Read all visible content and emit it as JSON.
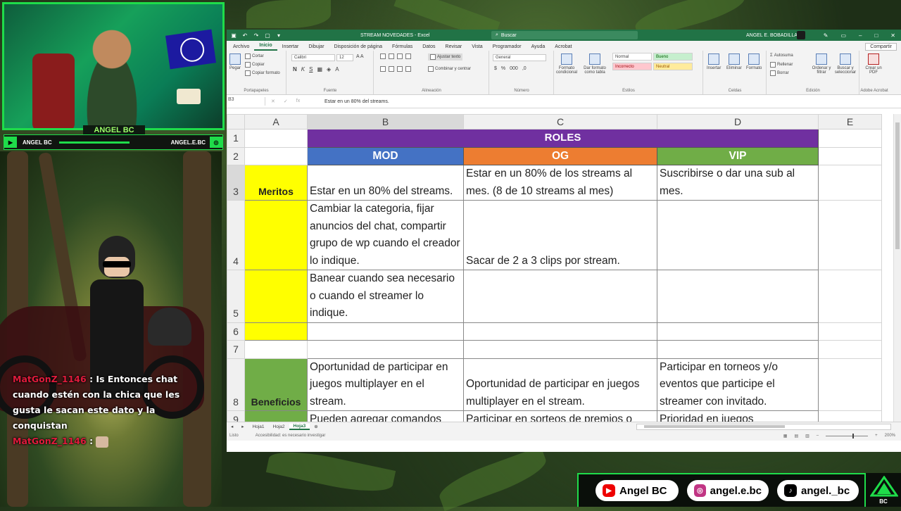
{
  "excel": {
    "title": {
      "doc": "STREAM NOVEDADES  -  Excel",
      "search": "Buscar",
      "user": "ANGEL E. BOBADILLA"
    },
    "tabs": [
      "Archivo",
      "Inicio",
      "Insertar",
      "Dibujar",
      "Disposición de página",
      "Fórmulas",
      "Datos",
      "Revisar",
      "Vista",
      "Programador",
      "Ayuda",
      "Acrobat"
    ],
    "share": "Compartir",
    "ribbon": {
      "clipboard": {
        "paste": "Pegar",
        "cut": "Cortar",
        "copy": "Copiar",
        "format_painter": "Copiar formato",
        "label": "Portapapeles"
      },
      "font": {
        "name": "Calibri",
        "size": "12",
        "label": "Fuente"
      },
      "alignment": {
        "wrap": "Ajustar texto",
        "merge": "Combinar y centrar",
        "label": "Alineación"
      },
      "number": {
        "format": "General",
        "label": "Número"
      },
      "styles": {
        "conditional": "Formato condicional",
        "as_table": "Dar formato como tabla",
        "normal": "Normal",
        "bueno": "Bueno",
        "incorrecto": "Incorrecto",
        "neutral": "Neutral",
        "label": "Estilos"
      },
      "cells": {
        "insert": "Insertar",
        "delete": "Eliminar",
        "format": "Formato",
        "label": "Celdas"
      },
      "editing": {
        "autosum": "Autosuma",
        "fill": "Rellenar",
        "clear": "Borrar",
        "sort": "Ordenar y filtrar",
        "find": "Buscar y seleccionar",
        "label": "Edición"
      },
      "pdf": {
        "create": "Crear un PDF",
        "label": "Adobe Acrobat"
      }
    },
    "formula_bar": {
      "name_box": "B3",
      "value": "Estar en un 80% del streams."
    },
    "columns": [
      "A",
      "B",
      "C",
      "D",
      "E"
    ],
    "rows": [
      "1",
      "2",
      "3",
      "4",
      "5",
      "6",
      "7",
      "8",
      "9"
    ],
    "cells": {
      "roles": "ROLES",
      "mod": "MOD",
      "og": "OG",
      "vip": "VIP",
      "meritos": "Meritos",
      "beneficios": "Beneficios",
      "b3": "Estar en un 80% del streams.",
      "c3": "Estar en un 80% de los streams al mes. (8 de 10 streams al mes)",
      "d3": "Suscribirse o dar una sub al mes.",
      "b4": "Cambiar la categoria, fijar anuncios del chat, compartir grupo de wp cuando el creador lo indique.",
      "c4": "Sacar de 2 a 3 clips por stream.",
      "b5": "Banear cuando sea necesario o cuando el streamer lo indique.",
      "b8": "Oportunidad de participar en juegos multiplayer en el stream.",
      "c8": "Oportunidad de participar en juegos multiplayer en el stream.",
      "d8": "Participar en torneos y/o eventos que participe el streamer con invitado.",
      "b9": "Pueden agregar comandos",
      "c9": "Participar en sorteos de premios o",
      "d9": "Prioridad en juegos"
    },
    "sheets": [
      "Hoja1",
      "Hoja2",
      "Hoja3"
    ],
    "active_sheet": "Hoja3",
    "status": {
      "ready": "Listo",
      "accessibility": "Accesibilidad: es necesario investigar",
      "zoom": "200%"
    }
  },
  "stream": {
    "cam_name": "ANGEL BC",
    "social_left": "ANGEL BC",
    "social_right": "ANGEL.E.BC",
    "chat": [
      {
        "user": "MatGonZ_1146",
        "text": ": Is Entonces chat cuando estén con la chica que les gusta le sacan este dato y la conquistan"
      },
      {
        "user": "MatGonZ_1146",
        "text": ":"
      }
    ],
    "bottom": {
      "youtube": "Angel BC",
      "instagram": "angel.e.bc",
      "tiktok": "angel._bc",
      "logo": "BC"
    }
  },
  "colors": {
    "excel_green": "#217346",
    "roles": "#7030a0",
    "mod": "#4472c4",
    "og": "#ed7d31",
    "vip": "#70ad47",
    "yellow": "#ffff00",
    "neon": "#1fdc4a"
  }
}
